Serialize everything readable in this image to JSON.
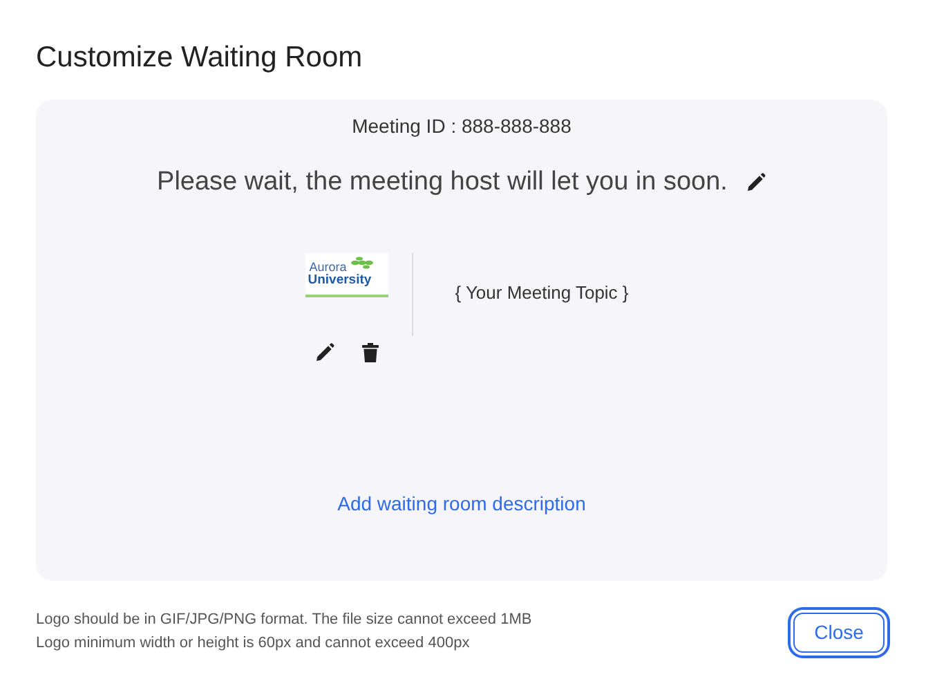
{
  "dialog": {
    "title": "Customize Waiting Room"
  },
  "preview": {
    "meeting_id": "Meeting ID : 888-888-888",
    "message": "Please wait, the meeting host will let you in soon.",
    "logo": {
      "line_1": "Aurora",
      "line_2": "University"
    },
    "topic": "{ Your Meeting Topic }",
    "description_link": "Add waiting room description"
  },
  "footer": {
    "notes": [
      "Logo should be in GIF/JPG/PNG format. The file size cannot exceed 1MB",
      "Logo minimum width or height is 60px and cannot exceed 400px"
    ],
    "buttons": [
      "Close"
    ]
  }
}
